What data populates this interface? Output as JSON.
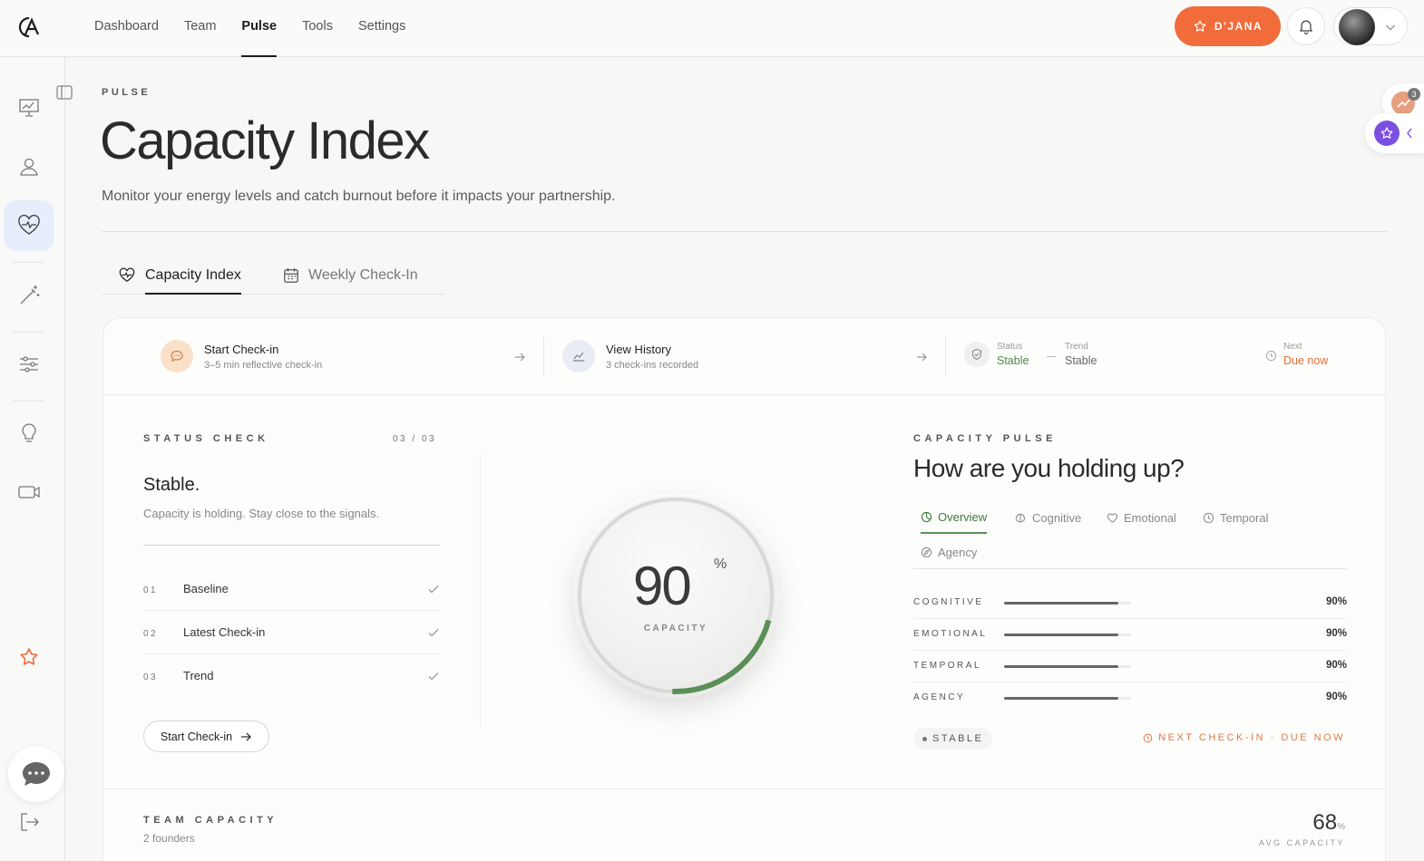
{
  "topbar": {
    "nav": [
      "Dashboard",
      "Team",
      "Pulse",
      "Tools",
      "Settings"
    ],
    "active_nav": "Pulse",
    "user_button_label": "D'JANA",
    "brand_color": "#f26b3a"
  },
  "rail": {
    "icons": [
      "presentation-chart-icon",
      "user-icon",
      "heart-pulse-icon",
      "magic-wand-icon",
      "sliders-icon",
      "lightbulb-icon",
      "video-icon",
      "star-icon",
      "chat-icon",
      "logout-icon"
    ],
    "active": "heart-pulse-icon"
  },
  "header": {
    "eyebrow": "PULSE",
    "title": "Capacity Index",
    "subtitle": "Monitor your energy levels and catch burnout before it impacts your partnership."
  },
  "tabs": [
    {
      "label": "Capacity Index",
      "active": true
    },
    {
      "label": "Weekly Check-In",
      "active": false
    }
  ],
  "actionbar": {
    "start": {
      "title": "Start Check-in",
      "sub": "3–5 min reflective check-in"
    },
    "history": {
      "title": "View History",
      "sub": "3 check-ins recorded"
    },
    "status": {
      "label": "Status",
      "value": "Stable"
    },
    "trend": {
      "label": "Trend",
      "value": "Stable"
    },
    "next": {
      "label": "Next",
      "value": "Due now"
    }
  },
  "status_check": {
    "label": "STATUS CHECK",
    "step": "03 / 03",
    "heading": "Stable.",
    "text": "Capacity is holding. Stay close to the signals.",
    "steps": [
      {
        "num": "01",
        "name": "Baseline"
      },
      {
        "num": "02",
        "name": "Latest Check-in"
      },
      {
        "num": "03",
        "name": "Trend"
      }
    ],
    "button": "Start Check-in"
  },
  "dial": {
    "value": "90",
    "unit": "%",
    "label": "CAPACITY",
    "accent_color": "#5b8f58"
  },
  "pulse": {
    "label": "CAPACITY PULSE",
    "heading": "How are you holding up?",
    "tabs": [
      "Overview",
      "Cognitive",
      "Emotional",
      "Temporal",
      "Agency"
    ],
    "active_tab": "Overview",
    "metrics": [
      {
        "name": "COGNITIVE",
        "value": "90%",
        "fraction": 0.9
      },
      {
        "name": "EMOTIONAL",
        "value": "90%",
        "fraction": 0.9
      },
      {
        "name": "TEMPORAL",
        "value": "90%",
        "fraction": 0.9
      },
      {
        "name": "AGENCY",
        "value": "90%",
        "fraction": 0.9
      }
    ],
    "status_pill": "STABLE",
    "next_checkin": "NEXT CHECK-IN · DUE NOW"
  },
  "team": {
    "label": "TEAM CAPACITY",
    "sub": "2 founders",
    "avg_value": "68",
    "avg_unit": "%",
    "avg_label": "AVG CAPACITY"
  },
  "floating": {
    "badge_count": "3"
  }
}
